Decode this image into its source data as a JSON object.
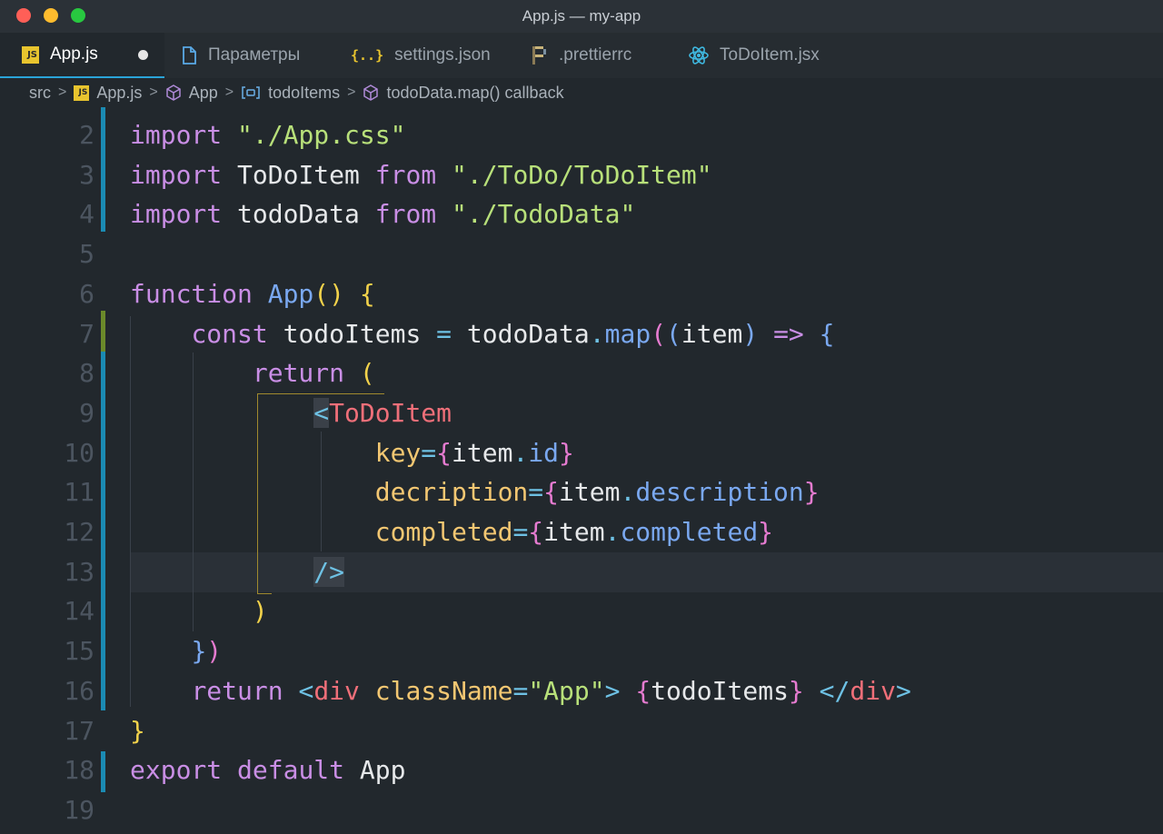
{
  "window": {
    "title": "App.js — my-app"
  },
  "tabs": [
    {
      "label": "App.js",
      "icon": "js-file-icon",
      "active": true,
      "modified": true
    },
    {
      "label": "Параметры",
      "icon": "document-icon"
    },
    {
      "label": "settings.json",
      "icon": "json-braces-icon"
    },
    {
      "label": ".prettierrc",
      "icon": "prettier-icon"
    },
    {
      "label": "ToDoItem.jsx",
      "icon": "react-icon"
    }
  ],
  "breadcrumb": [
    {
      "label": "src"
    },
    {
      "label": "App.js",
      "icon": "js-file-icon"
    },
    {
      "label": "App",
      "icon": "cube-icon"
    },
    {
      "label": "todoItems",
      "icon": "variable-icon"
    },
    {
      "label": "todoData.map() callback",
      "icon": "cube-icon"
    }
  ],
  "editor": {
    "line_numbers": [
      "2",
      "3",
      "4",
      "5",
      "6",
      "7",
      "8",
      "9",
      "10",
      "11",
      "12",
      "13",
      "14",
      "15",
      "16",
      "17",
      "18",
      "19"
    ],
    "current_line": "13",
    "lines": [
      [
        [
          "k",
          "import"
        ],
        [
          "w",
          " "
        ],
        [
          "s",
          "\"./App.css\""
        ]
      ],
      [
        [
          "k",
          "import"
        ],
        [
          "w",
          " ToDoItem "
        ],
        [
          "k",
          "from"
        ],
        [
          "w",
          " "
        ],
        [
          "s",
          "\"./ToDo/ToDoItem\""
        ]
      ],
      [
        [
          "k",
          "import"
        ],
        [
          "w",
          " todoData "
        ],
        [
          "k",
          "from"
        ],
        [
          "w",
          " "
        ],
        [
          "s",
          "\"./TodoData\""
        ]
      ],
      [],
      [
        [
          "k",
          "function"
        ],
        [
          "w",
          " "
        ],
        [
          "f",
          "App"
        ],
        [
          "y",
          "()"
        ],
        [
          "w",
          " "
        ],
        [
          "y",
          "{"
        ]
      ],
      [
        [
          "w",
          "    "
        ],
        [
          "k",
          "const"
        ],
        [
          "w",
          " todoItems "
        ],
        [
          "c",
          "="
        ],
        [
          "w",
          " todoData"
        ],
        [
          "c",
          "."
        ],
        [
          "f",
          "map"
        ],
        [
          "m",
          "("
        ],
        [
          "p",
          "("
        ],
        [
          "w",
          "item"
        ],
        [
          "p",
          ")"
        ],
        [
          "w",
          " "
        ],
        [
          "k",
          "=>"
        ],
        [
          "w",
          " "
        ],
        [
          "p",
          "{"
        ]
      ],
      [
        [
          "w",
          "        "
        ],
        [
          "k",
          "return"
        ],
        [
          "w",
          " "
        ],
        [
          "y",
          "("
        ]
      ],
      [
        [
          "w",
          "            "
        ],
        [
          "c",
          "<"
        ],
        [
          "t",
          "ToDoItem"
        ]
      ],
      [
        [
          "w",
          "                "
        ],
        [
          "a",
          "key"
        ],
        [
          "c",
          "="
        ],
        [
          "m",
          "{"
        ],
        [
          "w",
          "item"
        ],
        [
          "c",
          "."
        ],
        [
          "f",
          "id"
        ],
        [
          "m",
          "}"
        ]
      ],
      [
        [
          "w",
          "                "
        ],
        [
          "a",
          "decription"
        ],
        [
          "c",
          "="
        ],
        [
          "m",
          "{"
        ],
        [
          "w",
          "item"
        ],
        [
          "c",
          "."
        ],
        [
          "f",
          "description"
        ],
        [
          "m",
          "}"
        ]
      ],
      [
        [
          "w",
          "                "
        ],
        [
          "a",
          "completed"
        ],
        [
          "c",
          "="
        ],
        [
          "m",
          "{"
        ],
        [
          "w",
          "item"
        ],
        [
          "c",
          "."
        ],
        [
          "f",
          "completed"
        ],
        [
          "m",
          "}"
        ]
      ],
      [
        [
          "w",
          "            "
        ],
        [
          "c",
          "/>"
        ]
      ],
      [
        [
          "w",
          "        "
        ],
        [
          "y",
          ")"
        ]
      ],
      [
        [
          "w",
          "    "
        ],
        [
          "p",
          "}"
        ],
        [
          "m",
          ")"
        ]
      ],
      [
        [
          "w",
          "    "
        ],
        [
          "k",
          "return"
        ],
        [
          "w",
          " "
        ],
        [
          "c",
          "<"
        ],
        [
          "t",
          "div"
        ],
        [
          "w",
          " "
        ],
        [
          "a",
          "className"
        ],
        [
          "c",
          "="
        ],
        [
          "s",
          "\"App\""
        ],
        [
          "c",
          ">"
        ],
        [
          "w",
          " "
        ],
        [
          "m",
          "{"
        ],
        [
          "w",
          "todoItems"
        ],
        [
          "m",
          "}"
        ],
        [
          "w",
          " "
        ],
        [
          "c",
          "</"
        ],
        [
          "t",
          "div"
        ],
        [
          "c",
          ">"
        ]
      ],
      [
        [
          "y",
          "}"
        ]
      ],
      [
        [
          "k",
          "export"
        ],
        [
          "w",
          " "
        ],
        [
          "k",
          "default"
        ],
        [
          "w",
          " App"
        ]
      ],
      []
    ]
  }
}
